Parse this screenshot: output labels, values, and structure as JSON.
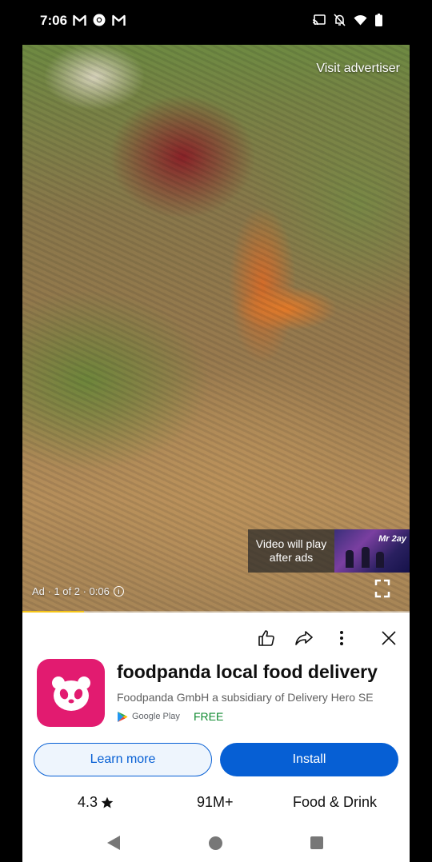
{
  "status_bar": {
    "time": "7:06",
    "left_icons": [
      "gmail-icon",
      "chrome-icon",
      "gmail-icon"
    ],
    "right_icons": [
      "cast-icon",
      "bell-off-icon",
      "wifi-icon",
      "battery-icon"
    ]
  },
  "video": {
    "visit_advertiser": "Visit advertiser",
    "preview_text_line1": "Video will play",
    "preview_text_line2": "after ads",
    "preview_thumb_title": "Mr 2ay",
    "ad_label": "Ad · 1 of 2 · 0:06",
    "progress_fraction": 0.16,
    "progress_color": "#f5c518"
  },
  "actions": [
    "like-icon",
    "share-icon",
    "more-options-icon",
    "close-icon"
  ],
  "app": {
    "title": "foodpanda local food delivery",
    "developer": "Foodpanda GmbH a subsidiary of Delivery Hero SE",
    "store": "Google Play",
    "price": "FREE",
    "icon_color": "#e21b70"
  },
  "buttons": {
    "learn_more": "Learn more",
    "install": "Install",
    "accent": "#065fd4"
  },
  "stats": {
    "rating": "4.3",
    "rating_icon": "star-icon",
    "downloads": "91M+",
    "category": "Food & Drink"
  },
  "nav": [
    "back-icon",
    "home-icon",
    "recents-icon"
  ]
}
